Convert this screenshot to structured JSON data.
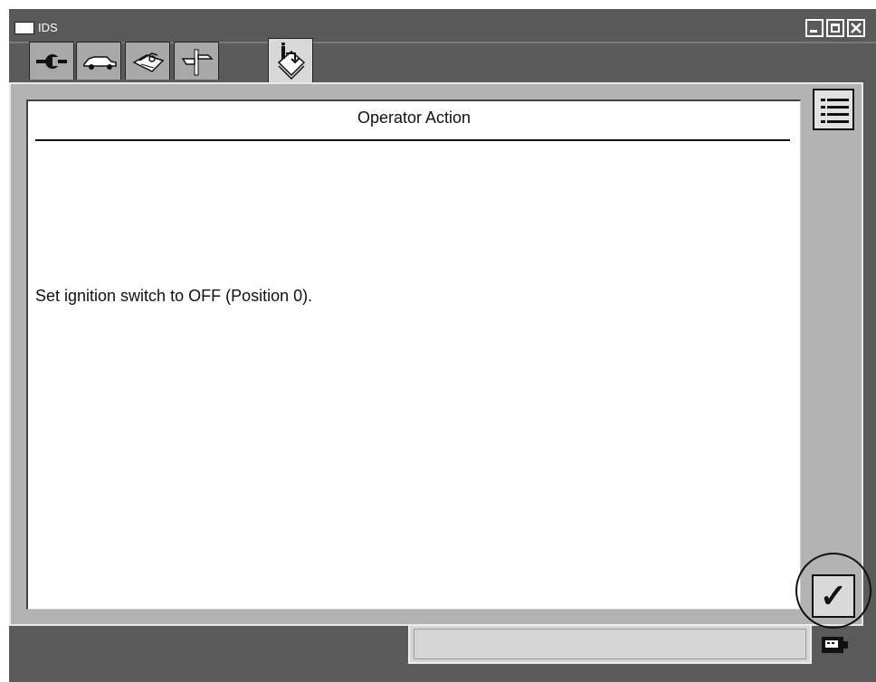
{
  "window": {
    "title": "IDS",
    "controls": [
      "minimize",
      "maximize",
      "close"
    ]
  },
  "tabs": [
    {
      "icon": "connector-icon",
      "active": false
    },
    {
      "icon": "vehicle-icon",
      "active": false
    },
    {
      "icon": "toolbox-icon",
      "active": false
    },
    {
      "icon": "signpost-icon",
      "active": false
    },
    {
      "icon": "info-manual-icon",
      "active": true
    }
  ],
  "dialog": {
    "heading": "Operator Action",
    "instruction": "Set ignition switch to OFF (Position 0)."
  },
  "side_buttons": {
    "list": {
      "icon": "list-icon"
    },
    "confirm": {
      "icon": "checkmark-icon",
      "glyph": "✓"
    }
  },
  "status_bar": {
    "value": "",
    "icon": "communication-status-icon"
  }
}
